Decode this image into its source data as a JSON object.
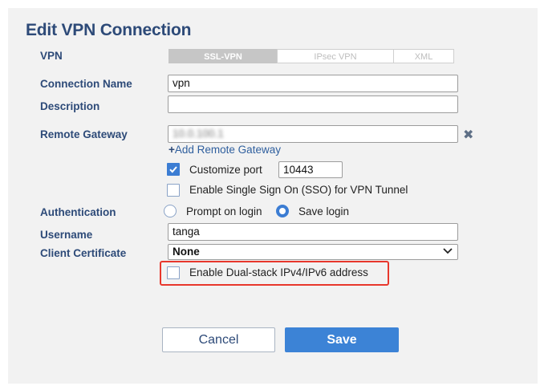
{
  "dialog": {
    "title": "Edit VPN Connection"
  },
  "vpn": {
    "label": "VPN",
    "tabs": [
      {
        "label": "SSL-VPN",
        "active": true
      },
      {
        "label": "IPsec VPN",
        "active": false
      },
      {
        "label": "XML",
        "active": false
      }
    ]
  },
  "connection_name": {
    "label": "Connection Name",
    "value": "vpn"
  },
  "description": {
    "label": "Description",
    "value": ""
  },
  "remote_gateway": {
    "label": "Remote Gateway",
    "value": "10.0.100.1",
    "remove_icon": "times-icon",
    "add_link": "Add Remote Gateway",
    "add_icon": "plus-icon"
  },
  "customize_port": {
    "label": "Customize port",
    "checked": true,
    "value": "10443"
  },
  "sso": {
    "label": "Enable Single Sign On (SSO) for VPN Tunnel",
    "checked": false
  },
  "authentication": {
    "label": "Authentication",
    "options": [
      {
        "label": "Prompt on login",
        "selected": false
      },
      {
        "label": "Save login",
        "selected": true
      }
    ]
  },
  "username": {
    "label": "Username",
    "value": "tanga"
  },
  "client_certificate": {
    "label": "Client Certificate",
    "value": "None"
  },
  "dual_stack": {
    "label": "Enable Dual-stack IPv4/IPv6 address",
    "checked": false
  },
  "buttons": {
    "cancel": "Cancel",
    "save": "Save"
  },
  "colors": {
    "accent": "#3c83d6",
    "heading": "#2d4a78",
    "highlight": "#e8372c",
    "panel": "#f2f2f2"
  }
}
